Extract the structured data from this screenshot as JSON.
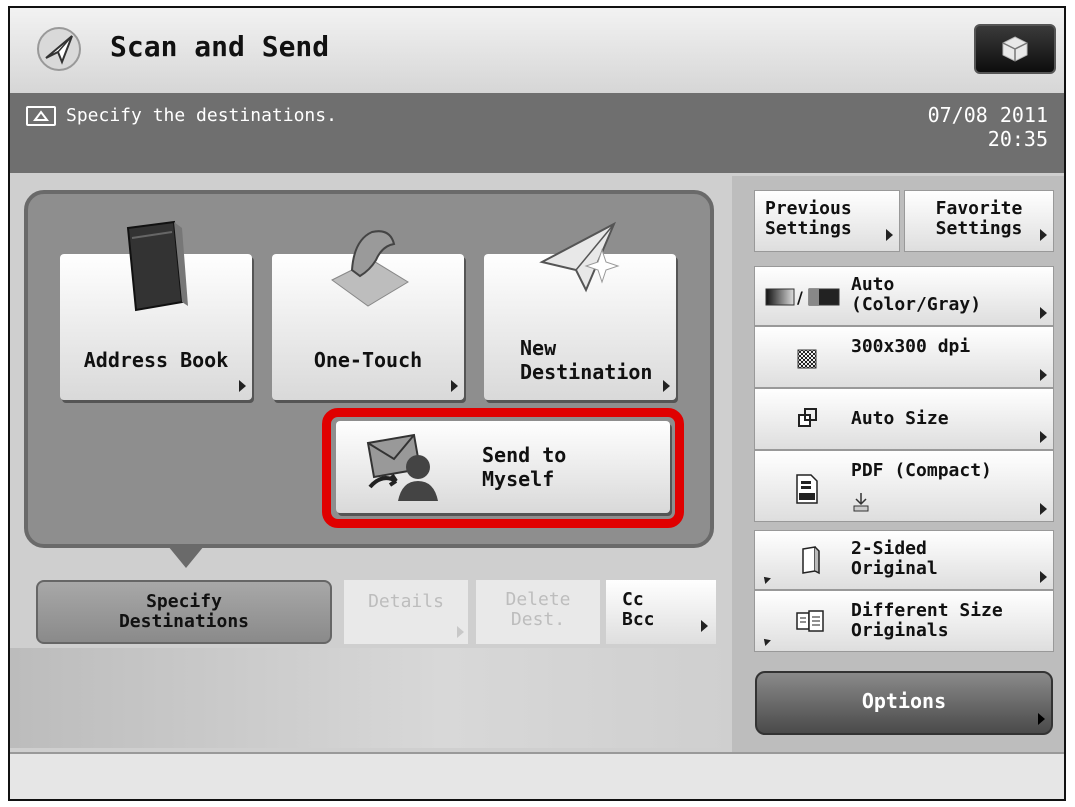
{
  "header": {
    "title": "Scan and Send"
  },
  "message_bar": {
    "text": "Specify the destinations.",
    "date": "07/08 2011",
    "time": "20:35"
  },
  "destination_panel": {
    "buttons": [
      {
        "label": "Address Book",
        "icon": "address-book-icon"
      },
      {
        "label": "One-Touch",
        "icon": "one-touch-icon"
      },
      {
        "label_line1": "New",
        "label_line2": "Destination",
        "icon": "new-destination-icon"
      }
    ],
    "send_to_myself": {
      "line1": "Send to",
      "line2": "Myself",
      "icon": "send-to-myself-icon"
    },
    "highlight_color": "#e00000"
  },
  "tabs": {
    "specify": {
      "line1": "Specify",
      "line2": "Destinations"
    },
    "details": "Details",
    "delete": {
      "line1": "Delete",
      "line2": "Dest."
    },
    "ccbcc": {
      "line1": "Cc",
      "line2": "Bcc"
    }
  },
  "settings": {
    "previous": {
      "line1": "Previous",
      "line2": "Settings"
    },
    "favorite": {
      "line1": "Favorite",
      "line2": "Settings"
    },
    "color": {
      "line1": "Auto",
      "line2": "(Color/Gray)",
      "icon": "color-mode-icon"
    },
    "resolution": {
      "label": "300x300 dpi",
      "icon": "resolution-icon"
    },
    "size": {
      "label": "Auto Size",
      "icon": "scan-size-icon"
    },
    "format": {
      "label": "PDF (Compact)",
      "icon": "file-format-icon"
    },
    "two_sided": {
      "line1": "2-Sided",
      "line2": "Original",
      "icon": "two-sided-icon"
    },
    "diff_size": {
      "line1": "Different Size",
      "line2": "Originals",
      "icon": "different-size-icon"
    },
    "options": "Options"
  }
}
